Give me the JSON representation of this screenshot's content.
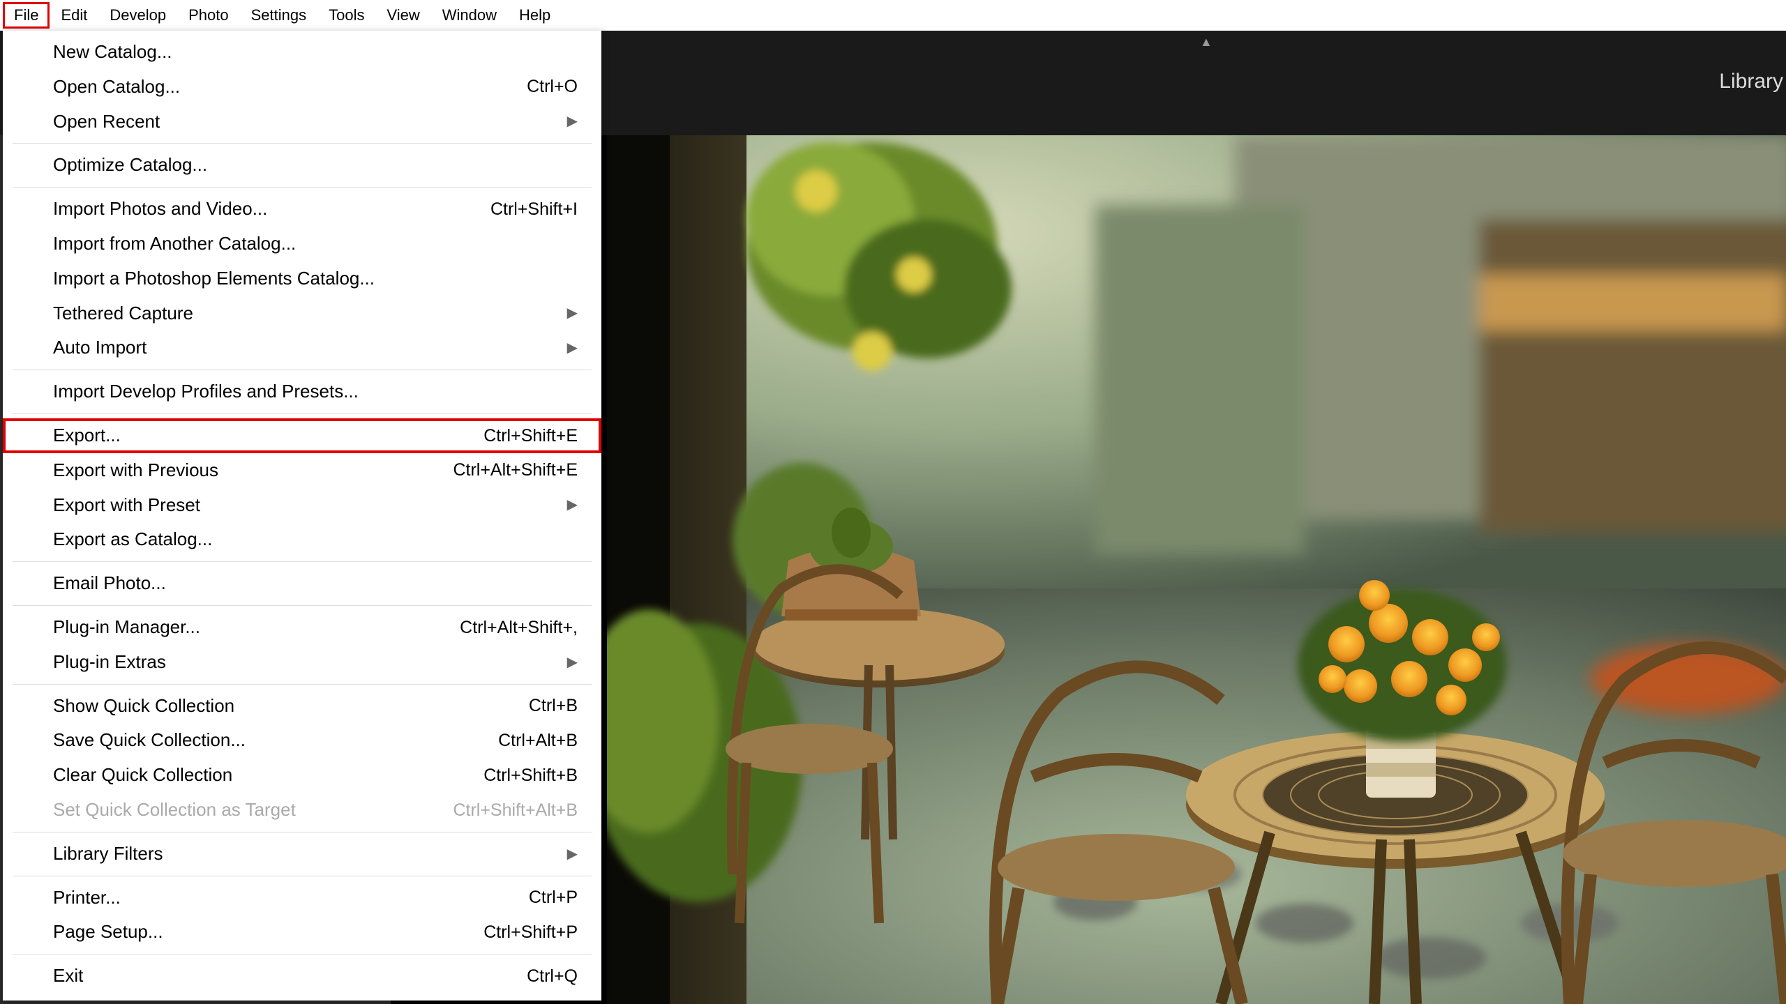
{
  "menubar": {
    "items": [
      "File",
      "Edit",
      "Develop",
      "Photo",
      "Settings",
      "Tools",
      "View",
      "Window",
      "Help"
    ],
    "active_index": 0
  },
  "module_label": "Library",
  "dropdown": {
    "groups": [
      [
        {
          "label": "New Catalog...",
          "shortcut": "",
          "submenu": false
        },
        {
          "label": "Open Catalog...",
          "shortcut": "Ctrl+O",
          "submenu": false
        },
        {
          "label": "Open Recent",
          "shortcut": "",
          "submenu": true
        }
      ],
      [
        {
          "label": "Optimize Catalog...",
          "shortcut": "",
          "submenu": false
        }
      ],
      [
        {
          "label": "Import Photos and Video...",
          "shortcut": "Ctrl+Shift+I",
          "submenu": false
        },
        {
          "label": "Import from Another Catalog...",
          "shortcut": "",
          "submenu": false
        },
        {
          "label": "Import a Photoshop Elements Catalog...",
          "shortcut": "",
          "submenu": false
        },
        {
          "label": "Tethered Capture",
          "shortcut": "",
          "submenu": true
        },
        {
          "label": "Auto Import",
          "shortcut": "",
          "submenu": true
        }
      ],
      [
        {
          "label": "Import Develop Profiles and Presets...",
          "shortcut": "",
          "submenu": false
        }
      ],
      [
        {
          "label": "Export...",
          "shortcut": "Ctrl+Shift+E",
          "submenu": false,
          "highlighted": true
        },
        {
          "label": "Export with Previous",
          "shortcut": "Ctrl+Alt+Shift+E",
          "submenu": false
        },
        {
          "label": "Export with Preset",
          "shortcut": "",
          "submenu": true
        },
        {
          "label": "Export as Catalog...",
          "shortcut": "",
          "submenu": false
        }
      ],
      [
        {
          "label": "Email Photo...",
          "shortcut": "",
          "submenu": false
        }
      ],
      [
        {
          "label": "Plug-in Manager...",
          "shortcut": "Ctrl+Alt+Shift+,",
          "submenu": false
        },
        {
          "label": "Plug-in Extras",
          "shortcut": "",
          "submenu": true
        }
      ],
      [
        {
          "label": "Show Quick Collection",
          "shortcut": "Ctrl+B",
          "submenu": false
        },
        {
          "label": "Save Quick Collection...",
          "shortcut": "Ctrl+Alt+B",
          "submenu": false
        },
        {
          "label": "Clear Quick Collection",
          "shortcut": "Ctrl+Shift+B",
          "submenu": false
        },
        {
          "label": "Set Quick Collection as Target",
          "shortcut": "Ctrl+Shift+Alt+B",
          "submenu": false,
          "disabled": true
        }
      ],
      [
        {
          "label": "Library Filters",
          "shortcut": "",
          "submenu": true
        }
      ],
      [
        {
          "label": "Printer...",
          "shortcut": "Ctrl+P",
          "submenu": false
        },
        {
          "label": "Page Setup...",
          "shortcut": "Ctrl+Shift+P",
          "submenu": false
        }
      ],
      [
        {
          "label": "Exit",
          "shortcut": "Ctrl+Q",
          "submenu": false
        }
      ]
    ]
  }
}
